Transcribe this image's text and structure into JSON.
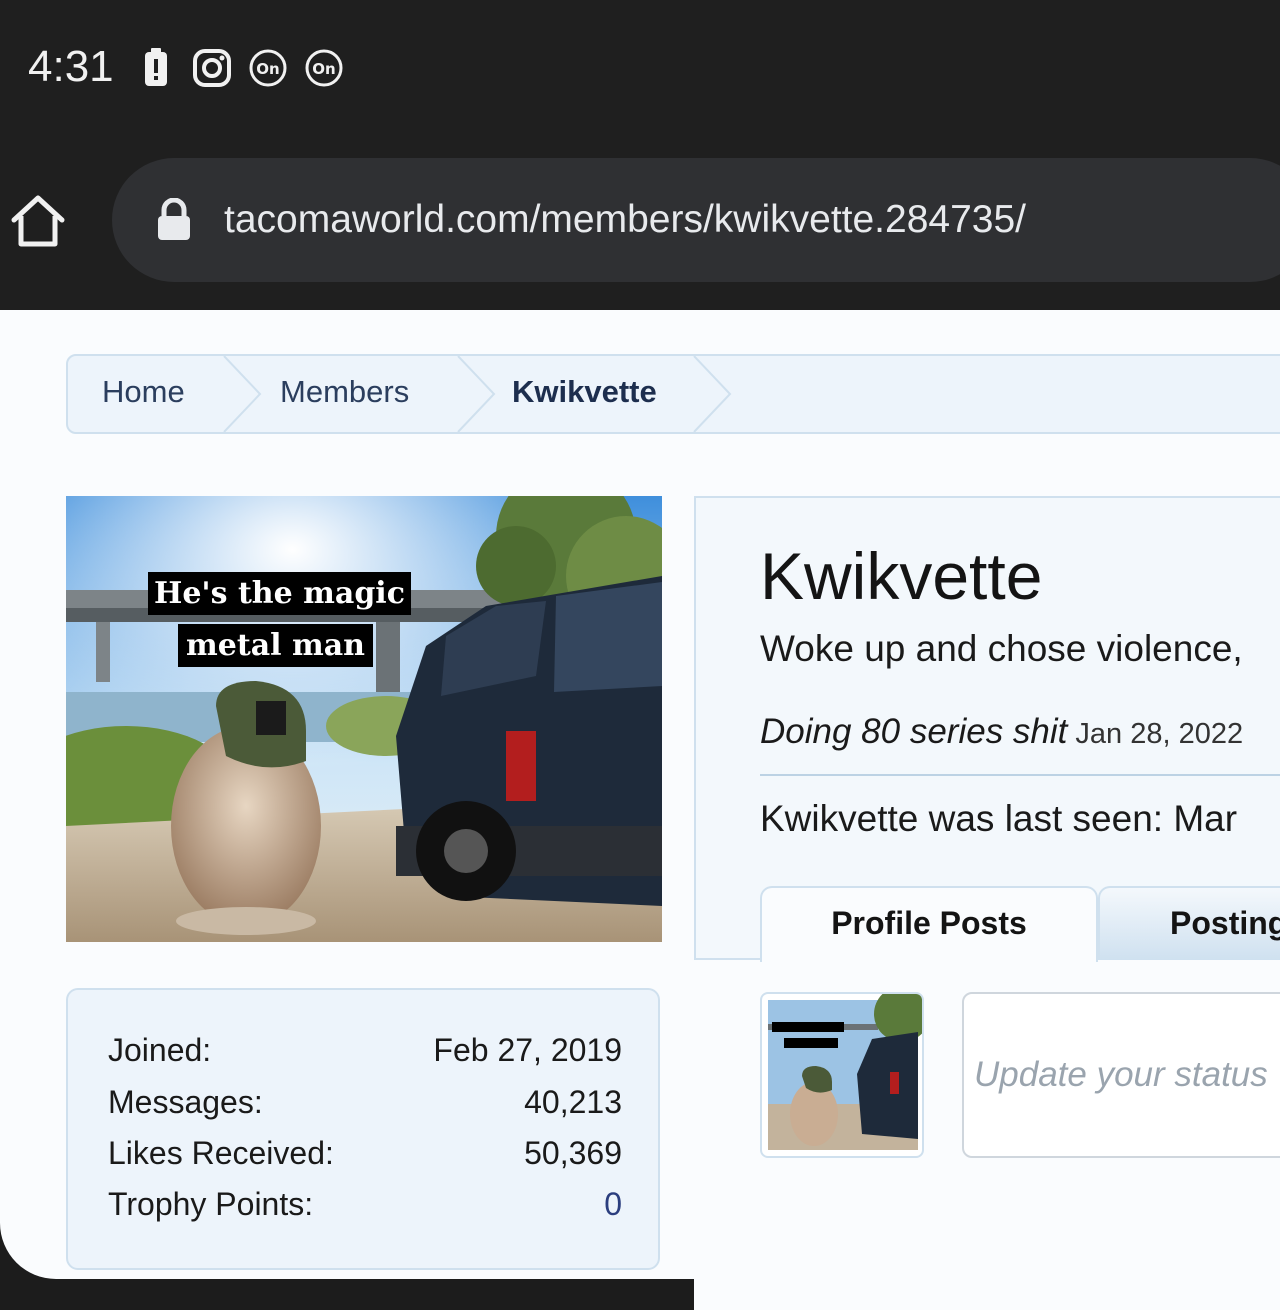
{
  "status_bar": {
    "time": "4:31",
    "icons": [
      "battery-alert-icon",
      "instagram-icon",
      "onx-icon",
      "onx-icon"
    ]
  },
  "browser": {
    "url": "tacomaworld.com/members/kwikvette.284735/",
    "icons": [
      "home-icon",
      "lock-icon"
    ]
  },
  "breadcrumb": {
    "items": [
      "Home",
      "Members",
      "Kwikvette"
    ]
  },
  "avatar": {
    "caption_line1": "He's the magic",
    "caption_line2": "metal man"
  },
  "stats": [
    {
      "label": "Joined:",
      "value": "Feb 27, 2019"
    },
    {
      "label": "Messages:",
      "value": "40,213"
    },
    {
      "label": "Likes Received:",
      "value": "50,369"
    },
    {
      "label": "Trophy Points:",
      "value": "0"
    }
  ],
  "profile": {
    "username": "Kwikvette",
    "user_title": "Woke up and chose violence,",
    "status_text": "Doing 80 series shit",
    "status_date": "Jan 28, 2022",
    "last_seen": "Kwikvette was last seen: Mar"
  },
  "tabs": [
    "Profile Posts",
    "Posting"
  ],
  "status_input": {
    "placeholder": "Update your status"
  },
  "colors": {
    "accent": "#2b3e5e",
    "panel": "#edf4fb",
    "border": "#cfe0ee"
  }
}
